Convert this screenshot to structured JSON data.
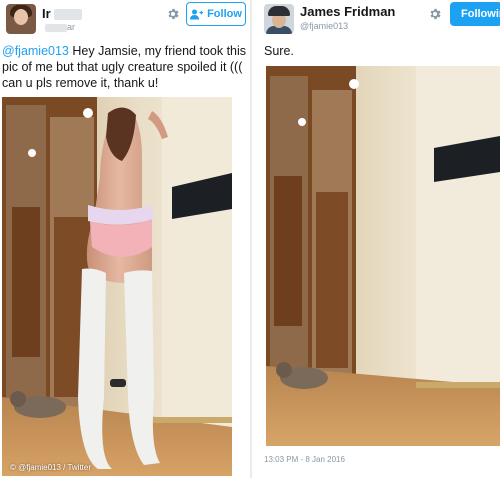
{
  "left_tweet": {
    "author_name": "Ir",
    "author_handle_tail": "ar",
    "follow_label": "Follow",
    "mention": "@fjamie013",
    "text": " Hey Jamsie, my friend took this pic of me but that ugly creature spoiled it ((( can u pls remove it, thank u!",
    "watermark": "© @fjamie013 / Twitter"
  },
  "right_tweet": {
    "author_name": "James Fridman",
    "author_handle": "@fjamie013",
    "follow_label": "Followin",
    "text": "Sure.",
    "timestamp": "13:03 PM - 8 Jan 2016"
  },
  "colors": {
    "twitter_blue": "#1da1f2",
    "muted": "#8899a6",
    "text": "#14171a"
  },
  "icons": {
    "settings": "gear-icon",
    "follow": "add-user-icon"
  }
}
